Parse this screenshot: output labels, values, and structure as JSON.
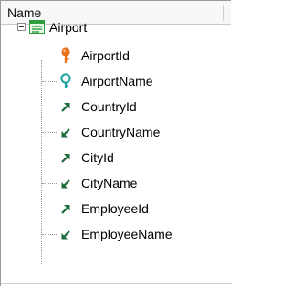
{
  "header": {
    "title": "Name"
  },
  "tree": {
    "root": {
      "label": "Airport",
      "icon": "transaction-table-icon",
      "expanded": true
    },
    "items": [
      {
        "label": "AirportId",
        "icon": "primary-key-icon"
      },
      {
        "label": "AirportName",
        "icon": "description-attribute-icon"
      },
      {
        "label": "CountryId",
        "icon": "foreign-key-icon"
      },
      {
        "label": "CountryName",
        "icon": "inferred-attribute-icon"
      },
      {
        "label": "CityId",
        "icon": "foreign-key-icon"
      },
      {
        "label": "CityName",
        "icon": "inferred-attribute-icon"
      },
      {
        "label": "EmployeeId",
        "icon": "foreign-key-icon"
      },
      {
        "label": "EmployeeName",
        "icon": "inferred-attribute-icon"
      }
    ]
  },
  "colors": {
    "primary_key": "#e8731c",
    "description": "#1aa3a3",
    "foreign_key": "#1c6b3a",
    "inferred": "#1c6b3a",
    "table_icon": "#2e9e3e"
  }
}
